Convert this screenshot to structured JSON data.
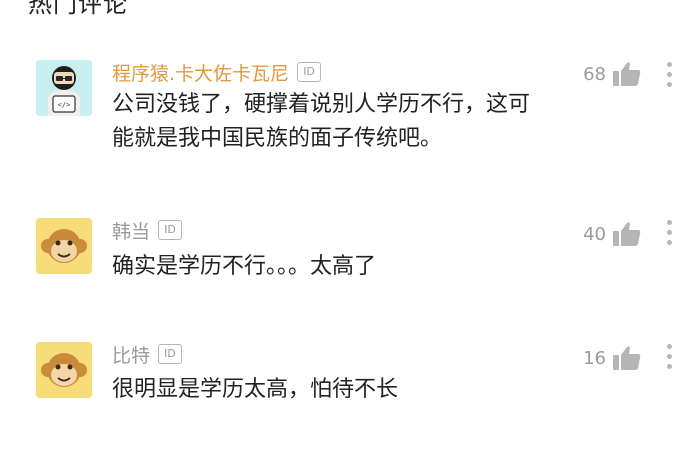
{
  "page": {
    "top_cut_text": "热门评论"
  },
  "comments": [
    {
      "username": "程序猿.卡大佐卡瓦尼",
      "username_color": "#e09a3c",
      "badge": "ID",
      "avatar_icon": "programmer-avatar-icon",
      "text_lines": [
        "公司没钱了，硬撑着说别人学历不行，这可",
        "能就是我中国民族的面子传统吧。"
      ],
      "likes": "68"
    },
    {
      "username": "韩当",
      "username_color": "#9b9b9b",
      "badge": "ID",
      "avatar_icon": "monkey-avatar-icon",
      "text_lines": [
        "确实是学历不行。。。太高了"
      ],
      "likes": "40"
    },
    {
      "username": "比特",
      "username_color": "#9b9b9b",
      "badge": "ID",
      "avatar_icon": "monkey-avatar-icon",
      "text_lines": [
        "很明显是学历太高，怕待不长"
      ],
      "likes": "16"
    }
  ],
  "colors": {
    "text": "#222222",
    "muted": "#9b9b9b",
    "accent_username": "#e09a3c",
    "avatar_bg_programmer": "#c9eef0",
    "avatar_bg_monkey": "#f7dd79"
  }
}
